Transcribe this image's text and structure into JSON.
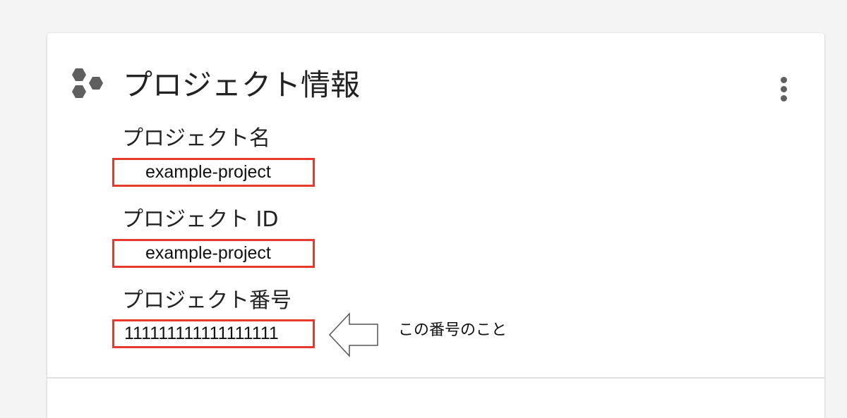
{
  "card": {
    "title": "プロジェクト情報",
    "header_icon": "hexagon-cluster-icon",
    "menu_icon": "more-vert-icon"
  },
  "fields": {
    "project_name": {
      "label": "プロジェクト名",
      "value": "example-project"
    },
    "project_id": {
      "label": "プロジェクト ID",
      "value": "example-project"
    },
    "project_number": {
      "label": "プロジェクト番号",
      "value": "111111111111111111"
    }
  },
  "annotation": {
    "text": "この番号のこと",
    "arrow_icon": "left-arrow-icon"
  },
  "colors": {
    "highlight_border": "#e8392f",
    "icon_gray": "#5f5f5f"
  }
}
